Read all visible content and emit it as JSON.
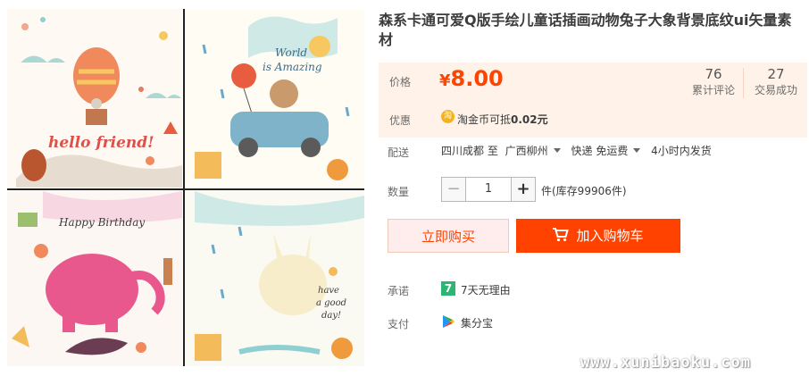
{
  "product": {
    "title": "森系卡通可爱Q版手绘儿童话插画动物兔子大象背景底纹ui矢量素材"
  },
  "illustrations": {
    "panel1_text": "hello friend!",
    "panel2_line1": "World",
    "panel2_line2": "is Amazing",
    "panel3_text": "Happy Birthday",
    "panel4_line1": "have",
    "panel4_line2": "a good",
    "panel4_line3": "day!"
  },
  "pricing": {
    "price_label": "价格",
    "currency": "¥",
    "amount": "8.00",
    "reviews_count": "76",
    "reviews_label": "累计评论",
    "sales_count": "27",
    "sales_label": "交易成功",
    "promo_label": "优惠",
    "coin_glyph": "淘",
    "promo_text": "淘金币可抵",
    "promo_value": "0.02元"
  },
  "shipping": {
    "label": "配送",
    "origin": "四川成都 至",
    "destination": "广西柳州",
    "method": "快递 免运费",
    "dispatch": "4小时内发货"
  },
  "quantity": {
    "label": "数量",
    "value": "1",
    "unit_stock": "件(库存99906件)"
  },
  "actions": {
    "buy_now": "立即购买",
    "add_to_cart": "加入购物车"
  },
  "promise": {
    "label": "承诺",
    "badge": "7",
    "text": "7天无理由"
  },
  "payment": {
    "label": "支付",
    "text": "集分宝"
  },
  "watermark": "www.xunibaoku.com",
  "colors": {
    "accent": "#ff4200",
    "price": "#ff4400",
    "price_bg": "#fff2e8"
  }
}
